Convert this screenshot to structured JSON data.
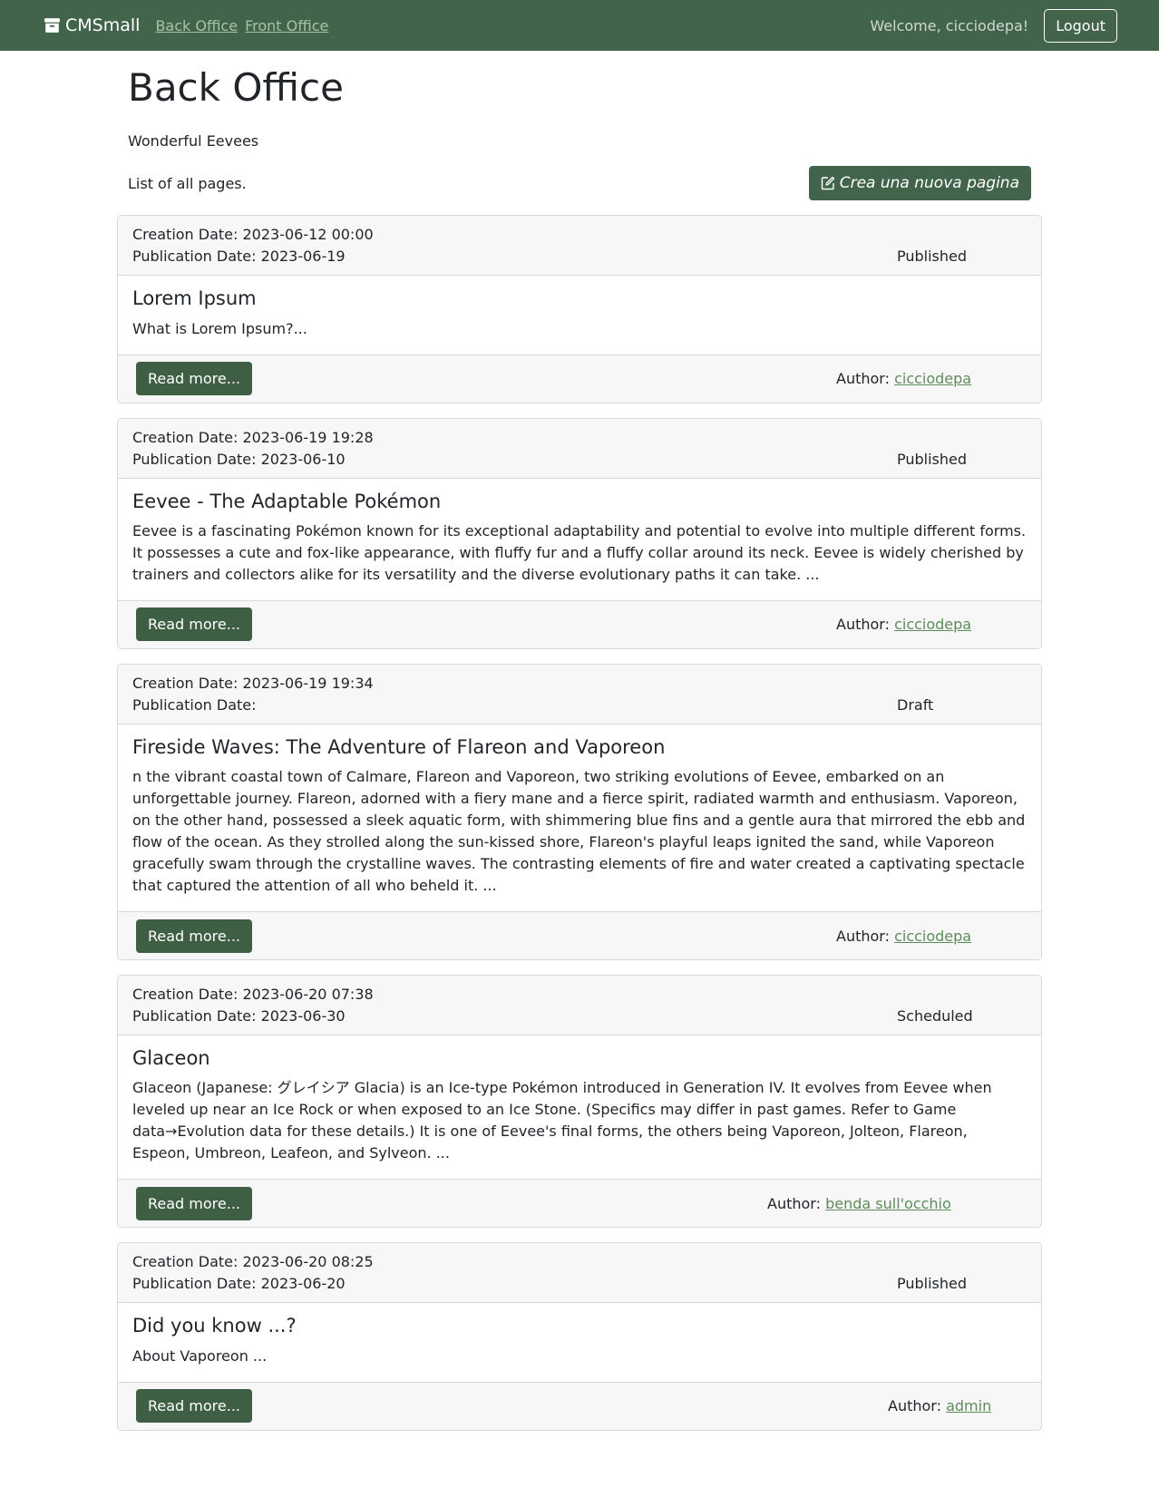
{
  "navbar": {
    "brand": "CMSmall",
    "links": [
      "Back Office",
      "Front Office"
    ],
    "welcome": "Welcome, cicciodepa!",
    "logout": "Logout"
  },
  "main": {
    "title": "Back Office",
    "site_name": "Wonderful Eevees",
    "list_label": "List of all pages.",
    "create_button": "Crea una nuova pagina"
  },
  "pages": [
    {
      "creation": "Creation Date: 2023-06-12 00:00",
      "publication": "Publication Date: 2023-06-19",
      "status": "Published",
      "title": "Lorem Ipsum",
      "text": "What is Lorem Ipsum?...",
      "read_more": "Read more...",
      "author_label": "Author:",
      "author": "cicciodepa"
    },
    {
      "creation": "Creation Date: 2023-06-19 19:28",
      "publication": "Publication Date: 2023-06-10",
      "status": "Published",
      "title": "Eevee - The Adaptable Pokémon",
      "text": "Eevee is a fascinating Pokémon known for its exceptional adaptability and potential to evolve into multiple different forms. It possesses a cute and fox-like appearance, with fluffy fur and a fluffy collar around its neck. Eevee is widely cherished by trainers and collectors alike for its versatility and the diverse evolutionary paths it can take. ...",
      "read_more": "Read more...",
      "author_label": "Author:",
      "author": "cicciodepa"
    },
    {
      "creation": "Creation Date: 2023-06-19 19:34",
      "publication": "Publication Date:",
      "status": "Draft",
      "title": "Fireside Waves: The Adventure of Flareon and Vaporeon",
      "text": "n the vibrant coastal town of Calmare, Flareon and Vaporeon, two striking evolutions of Eevee, embarked on an unforgettable journey. Flareon, adorned with a fiery mane and a fierce spirit, radiated warmth and enthusiasm. Vaporeon, on the other hand, possessed a sleek aquatic form, with shimmering blue fins and a gentle aura that mirrored the ebb and flow of the ocean. As they strolled along the sun-kissed shore, Flareon's playful leaps ignited the sand, while Vaporeon gracefully swam through the crystalline waves. The contrasting elements of fire and water created a captivating spectacle that captured the attention of all who beheld it. ...",
      "read_more": "Read more...",
      "author_label": "Author:",
      "author": "cicciodepa"
    },
    {
      "creation": "Creation Date: 2023-06-20 07:38",
      "publication": "Publication Date: 2023-06-30",
      "status": "Scheduled",
      "title": "Glaceon",
      "text": "Glaceon (Japanese: グレイシア Glacia) is an Ice-type Pokémon introduced in Generation IV. It evolves from Eevee when leveled up near an Ice Rock or when exposed to an Ice Stone. (Specifics may differ in past games. Refer to Game data→Evolution data for these details.) It is one of Eevee's final forms, the others being Vaporeon, Jolteon, Flareon, Espeon, Umbreon, Leafeon, and Sylveon. ...",
      "read_more": "Read more...",
      "author_label": "Author:",
      "author": "benda sull'occhio"
    },
    {
      "creation": "Creation Date: 2023-06-20 08:25",
      "publication": "Publication Date: 2023-06-20",
      "status": "Published",
      "title": "Did you know ...?",
      "text": "About Vaporeon ...",
      "read_more": "Read more...",
      "author_label": "Author:",
      "author": "admin"
    }
  ]
}
